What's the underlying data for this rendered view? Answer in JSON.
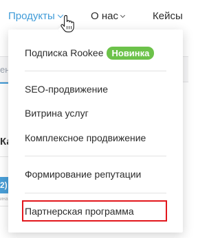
{
  "nav": {
    "products": "Продукты",
    "about": "О нас",
    "cases": "Кейсы"
  },
  "background": {
    "band_fragment": "ен",
    "heading_fragment": "Ка",
    "box_fragment": "2)",
    "small_fragment": "ина"
  },
  "dropdown": {
    "items": [
      {
        "label": "Подписка Rookee",
        "badge": "Новинка"
      },
      {
        "label": "SEO-продвижение"
      },
      {
        "label": "Витрина услуг"
      },
      {
        "label": "Комплексное продвижение"
      },
      {
        "label": "Формирование репутации"
      },
      {
        "label": "Партнерская программа"
      }
    ]
  },
  "colors": {
    "accent": "#3f9bd8",
    "badge": "#6cc24a",
    "highlight": "#e2151b",
    "text": "#2b2b2b"
  },
  "icons": {
    "cursor": "hand-pointer-icon",
    "products_chevron": "chevron-down-icon",
    "about_chevron": "chevron-down-icon"
  }
}
